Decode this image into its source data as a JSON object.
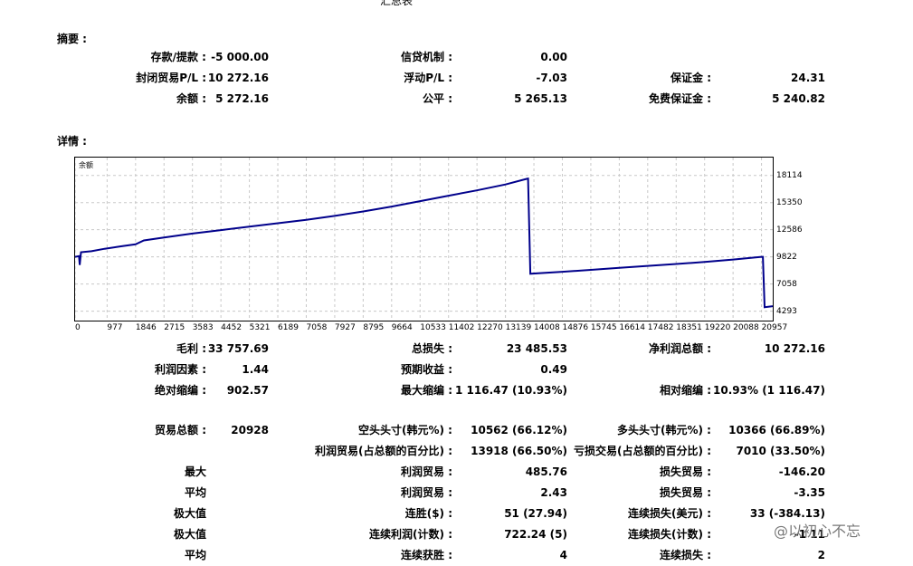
{
  "report_title": "汇总表",
  "summary": {
    "heading": "摘要 :",
    "rows": [
      [
        [
          "存款/提款 :",
          "-5 000.00"
        ],
        [
          "信贷机制 :",
          "0.00"
        ],
        [
          "",
          ""
        ]
      ],
      [
        [
          "封闭贸易P/L :",
          "10 272.16"
        ],
        [
          "浮动P/L :",
          "-7.03"
        ],
        [
          "保证金 :",
          "24.31"
        ]
      ],
      [
        [
          "余额 :",
          "5 272.16"
        ],
        [
          "公平 :",
          "5 265.13"
        ],
        [
          "免费保证金 :",
          "5 240.82"
        ]
      ]
    ]
  },
  "details": {
    "heading": "详情 :",
    "rows_a": [
      [
        [
          "毛利 :",
          "33 757.69"
        ],
        [
          "总损失 :",
          "23 485.53"
        ],
        [
          "净利润总额 :",
          "10 272.16"
        ]
      ],
      [
        [
          "利润因素 :",
          "1.44"
        ],
        [
          "预期收益 :",
          "0.49"
        ],
        [
          "",
          ""
        ]
      ],
      [
        [
          "绝对缩编 :",
          "902.57"
        ],
        [
          "最大缩编 :",
          "1 116.47 (10.93%)"
        ],
        [
          "相对缩编 :",
          "10.93% (1 116.47)"
        ]
      ]
    ],
    "rows_b": [
      [
        [
          "贸易总额 :",
          "20928"
        ],
        [
          "空头头寸(韩元%) :",
          "10562 (66.12%)"
        ],
        [
          "多头头寸(韩元%) :",
          "10366 (66.89%)"
        ]
      ],
      [
        [
          "",
          ""
        ],
        [
          "利润贸易(占总额的百分比) :",
          "13918 (66.50%)"
        ],
        [
          "亏损交易(占总额的百分比) :",
          "7010 (33.50%)"
        ]
      ],
      [
        [
          "最大",
          ""
        ],
        [
          "利润贸易 :",
          "485.76"
        ],
        [
          "损失贸易 :",
          "-146.20"
        ]
      ],
      [
        [
          "平均",
          ""
        ],
        [
          "利润贸易 :",
          "2.43"
        ],
        [
          "损失贸易 :",
          "-3.35"
        ]
      ],
      [
        [
          "极大值",
          ""
        ],
        [
          "连胜($) :",
          "51 (27.94)"
        ],
        [
          "连续损失(美元) :",
          "33 (-384.13)"
        ]
      ],
      [
        [
          "极大值",
          ""
        ],
        [
          "连续利润(计数) :",
          "722.24 (5)"
        ],
        [
          "连续损失(计数) :",
          "-1 11"
        ]
      ],
      [
        [
          "平均",
          ""
        ],
        [
          "连续获胜 :",
          "4"
        ],
        [
          "连续损失 :",
          "2"
        ]
      ]
    ]
  },
  "watermark": "@以初心不忘",
  "chart_data": {
    "type": "line",
    "legend": "余额",
    "x_ticks": [
      "0",
      "977",
      "1846",
      "2715",
      "3583",
      "4452",
      "5321",
      "6189",
      "7058",
      "7927",
      "8795",
      "9664",
      "10533",
      "11402",
      "12270",
      "13139",
      "14008",
      "14876",
      "15745",
      "16614",
      "17482",
      "18351",
      "19220",
      "20088",
      "20957"
    ],
    "y_ticks": [
      "18114",
      "15350",
      "12586",
      "9822",
      "7058",
      "4293"
    ],
    "ylim": [
      3700,
      19200
    ],
    "xlim": [
      0,
      21300
    ],
    "grid": true,
    "line_color": "#00008b",
    "series": [
      {
        "x": [
          0,
          120,
          140,
          180,
          500,
          900,
          1400,
          1846,
          2100,
          2715,
          3583,
          4452,
          5321,
          6189,
          7058,
          7927,
          8795,
          9664,
          10533,
          11402,
          12270,
          13139,
          13800,
          13830,
          13900,
          14876,
          15745,
          16614,
          17482,
          18351,
          19220,
          20088,
          20957,
          21000,
          21050,
          21300
        ],
        "y": [
          9822,
          9900,
          9000,
          10300,
          10400,
          10650,
          10900,
          11100,
          11500,
          11800,
          12200,
          12550,
          12900,
          13250,
          13600,
          14000,
          14450,
          14950,
          15500,
          16050,
          16600,
          17200,
          17780,
          17800,
          8100,
          8300,
          8500,
          8700,
          8900,
          9100,
          9300,
          9550,
          9822,
          9822,
          4700,
          4800
        ]
      }
    ]
  }
}
